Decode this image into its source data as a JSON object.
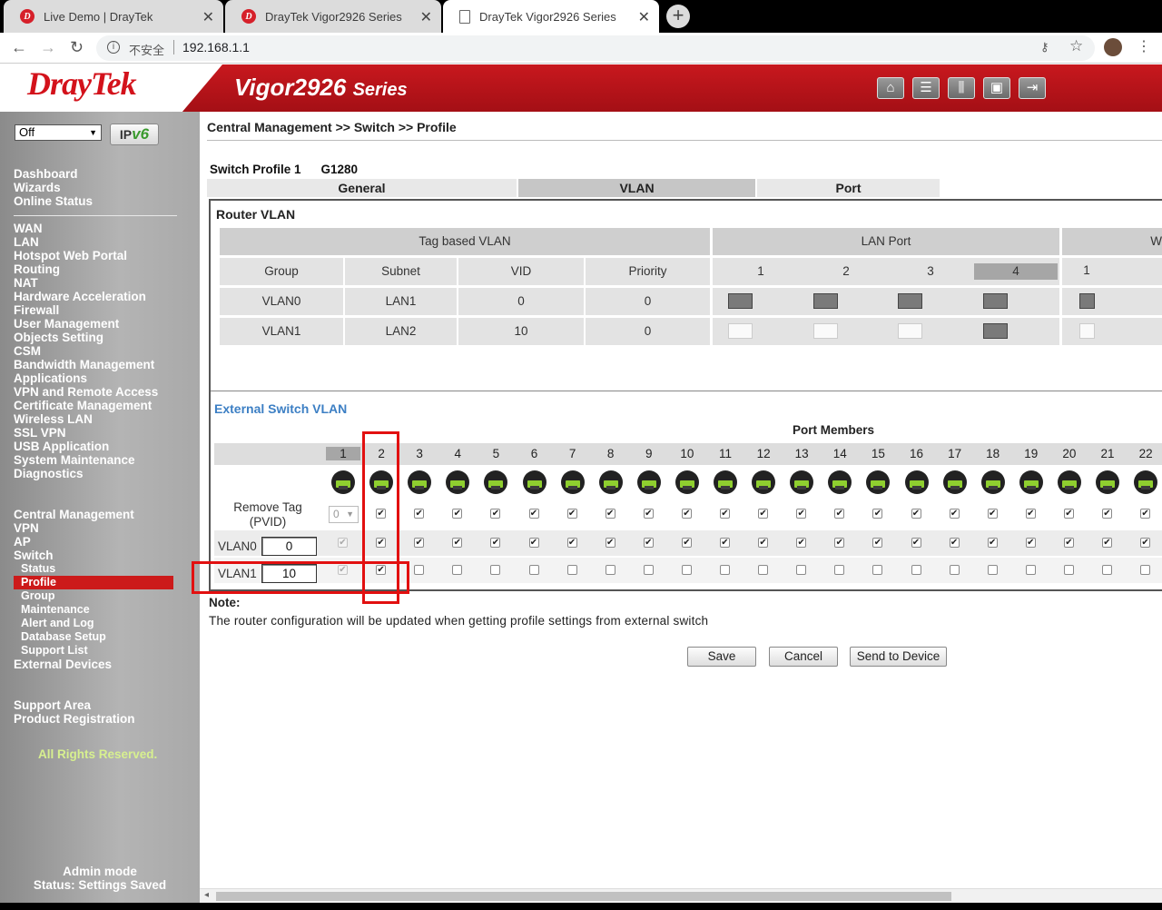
{
  "browser": {
    "tabs": [
      {
        "title": "Live Demo | DrayTek",
        "active": false,
        "fav": "draytek-favicon"
      },
      {
        "title": "DrayTek Vigor2926 Series",
        "active": false,
        "fav": "draytek-favicon"
      },
      {
        "title": "DrayTek Vigor2926 Series",
        "active": true,
        "fav": "page-favicon"
      }
    ],
    "insecure_label": "不安全",
    "url": "192.168.1.1"
  },
  "header": {
    "logo": "DrayTek",
    "model": "Vigor2926",
    "series": "Series",
    "buttons": [
      "home-icon",
      "quick-start-icon",
      "settings-icon",
      "save-icon",
      "logout-icon"
    ]
  },
  "sidebar": {
    "mode_select": "Off",
    "ipv6_label": "IPv6",
    "group1": [
      "Dashboard",
      "Wizards",
      "Online Status"
    ],
    "group2": [
      "WAN",
      "LAN",
      "Hotspot Web Portal",
      "Routing",
      "NAT",
      "Hardware Acceleration",
      "Firewall",
      "User Management",
      "Objects Setting",
      "CSM",
      "Bandwidth Management",
      "Applications",
      "VPN and Remote Access",
      "Certificate Management",
      "Wireless LAN",
      "SSL VPN",
      "USB Application",
      "System Maintenance",
      "Diagnostics"
    ],
    "group3": [
      "Central Management",
      "VPN",
      "AP",
      "Switch"
    ],
    "switch_sub": [
      "Status",
      "Profile",
      "Group",
      "Maintenance",
      "Alert and Log",
      "Database Setup",
      "Support List"
    ],
    "external": "External Devices",
    "group4": [
      "Support Area",
      "Product Registration"
    ],
    "rights": "All Rights Reserved.",
    "admin_mode": "Admin mode",
    "status": "Status: Settings Saved"
  },
  "main": {
    "breadcrumb": "Central Management >> Switch >> Profile",
    "profile_label": "Switch Profile 1",
    "profile_model": "G1280",
    "tabs": [
      "General",
      "VLAN",
      "Port"
    ],
    "router_vlan": {
      "title": "Router VLAN",
      "group_tag": "Tag based VLAN",
      "group_lan": "LAN Port",
      "group_w": "W",
      "columns": [
        "Group",
        "Subnet",
        "VID",
        "Priority"
      ],
      "lan_ports": [
        "1",
        "2",
        "3",
        "4"
      ],
      "w_ports": [
        "1"
      ],
      "rows": [
        {
          "group": "VLAN0",
          "subnet": "LAN1",
          "vid": "0",
          "priority": "0",
          "lan": [
            true,
            true,
            true,
            true
          ],
          "w": [
            true
          ]
        },
        {
          "group": "VLAN1",
          "subnet": "LAN2",
          "vid": "10",
          "priority": "0",
          "lan": [
            false,
            false,
            false,
            true
          ],
          "w": [
            false
          ]
        }
      ]
    },
    "external_vlan": {
      "title": "External Switch VLAN",
      "port_members": "Port Members",
      "ports": [
        "1",
        "2",
        "3",
        "4",
        "5",
        "6",
        "7",
        "8",
        "9",
        "10",
        "11",
        "12",
        "13",
        "14",
        "15",
        "16",
        "17",
        "18",
        "19",
        "20",
        "21",
        "22"
      ],
      "remove_tag_label": "Remove Tag",
      "pvid_label": "(PVID)",
      "pvid_value": "0",
      "vlan_rows": [
        {
          "label": "VLAN0",
          "vid": "0"
        },
        {
          "label": "VLAN1",
          "vid": "10"
        }
      ]
    },
    "note_title": "Note:",
    "note_text": "The router configuration will be updated when getting profile settings from external switch",
    "buttons": {
      "save": "Save",
      "cancel": "Cancel",
      "send": "Send to Device"
    }
  }
}
